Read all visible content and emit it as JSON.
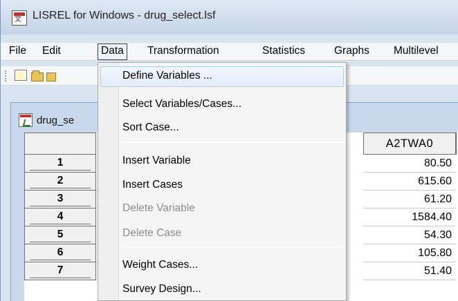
{
  "window": {
    "title": "LISREL for Windows - drug_select.lsf"
  },
  "menubar": {
    "items": [
      {
        "label": "File"
      },
      {
        "label": "Edit"
      },
      {
        "label": "Data"
      },
      {
        "label": "Transformation"
      },
      {
        "label": "Statistics"
      },
      {
        "label": "Graphs"
      },
      {
        "label": "Multilevel"
      }
    ],
    "active": "Data"
  },
  "toolbar": {
    "icons": [
      "new-file-icon",
      "open-folder-icon",
      "save-folder-icon"
    ]
  },
  "document": {
    "title": "drug_se"
  },
  "dropdown": {
    "items": [
      {
        "label": "Define Variables ...",
        "enabled": true,
        "highlighted": true
      },
      {
        "label": "Select Variables/Cases...",
        "enabled": true
      },
      {
        "label": "Sort Case...",
        "enabled": true
      },
      {
        "label": "Insert Variable",
        "enabled": true
      },
      {
        "label": "Insert Cases",
        "enabled": true
      },
      {
        "label": "Delete Variable",
        "enabled": false
      },
      {
        "label": "Delete Case",
        "enabled": false
      },
      {
        "label": "Weight Cases...",
        "enabled": true
      },
      {
        "label": "Survey Design...",
        "enabled": true
      }
    ]
  },
  "grid": {
    "column_header": "A2TWA0",
    "rows": [
      {
        "index": "1",
        "value": "80.50"
      },
      {
        "index": "2",
        "value": "615.60"
      },
      {
        "index": "3",
        "value": "61.20"
      },
      {
        "index": "4",
        "value": "1584.40"
      },
      {
        "index": "5",
        "value": "54.30"
      },
      {
        "index": "6",
        "value": "105.80"
      },
      {
        "index": "7",
        "value": "51.40"
      }
    ]
  },
  "colors": {
    "titlebar": "#cfdced",
    "menu_bg": "#f5f6f7",
    "menu_highlight_border": "#aecbf0",
    "disabled_text": "#8d8d8d"
  }
}
